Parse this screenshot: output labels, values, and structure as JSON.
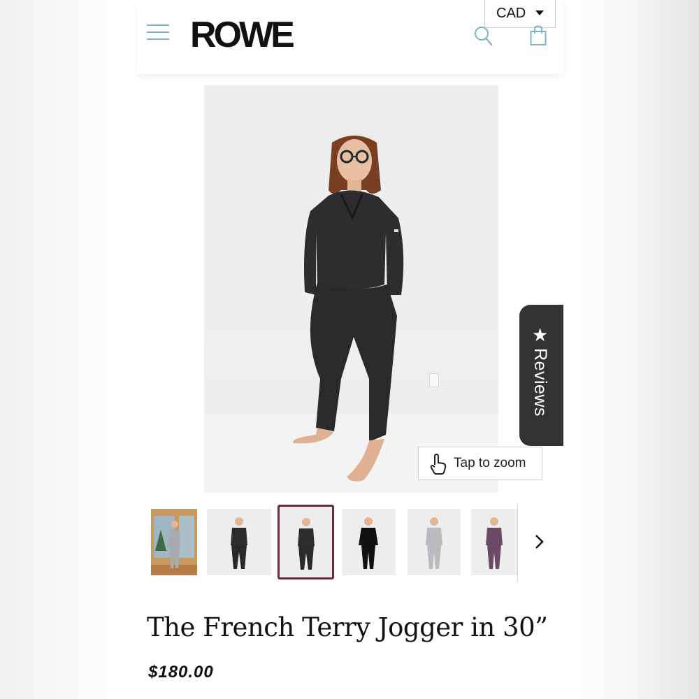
{
  "header": {
    "logo": "ROWE",
    "currency": "CAD",
    "menu_icon": "hamburger-menu-icon",
    "search_icon": "search-icon",
    "cart_icon": "shopping-bag-icon"
  },
  "gallery": {
    "zoom_label": "Tap to zoom",
    "zoom_icon": "hand-pointer-icon",
    "thumbnail_count": 6,
    "active_thumbnail": 3,
    "next_icon": "chevron-right-icon"
  },
  "reviews": {
    "label": "Reviews",
    "icon": "star-icon"
  },
  "product": {
    "title": "The French Terry Jogger in 30”",
    "price": "$180.00"
  },
  "colors": {
    "accent_icons": "#7fb3c8",
    "active_thumb_border": "#6b2a3a",
    "reviews_tab": "#333333"
  }
}
